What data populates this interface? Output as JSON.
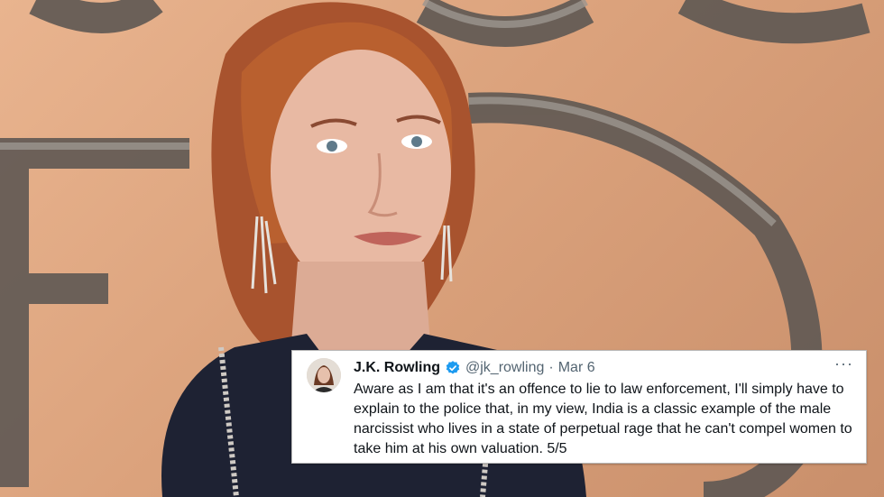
{
  "tweet": {
    "author_name": "J.K. Rowling",
    "handle": "@jk_rowling",
    "separator": "·",
    "timestamp": "Mar 6",
    "more": "···",
    "text": "Aware as I am that it's an offence to lie to law enforcement, I'll simply have to explain to the police that, in my view, India is a classic example of the male narcissist who lives in a state of perpetual rage that he can't compel women to take him at his own valuation. 5/5",
    "verified_icon": "verified-badge-icon",
    "colors": {
      "verified": "#1d9bf0",
      "text": "#0f1419",
      "secondary": "#536471"
    }
  },
  "photo": {
    "subject": "woman-with-red-hair-at-premiere",
    "background_colors": [
      "#e9b48f",
      "#c98f6b"
    ]
  }
}
